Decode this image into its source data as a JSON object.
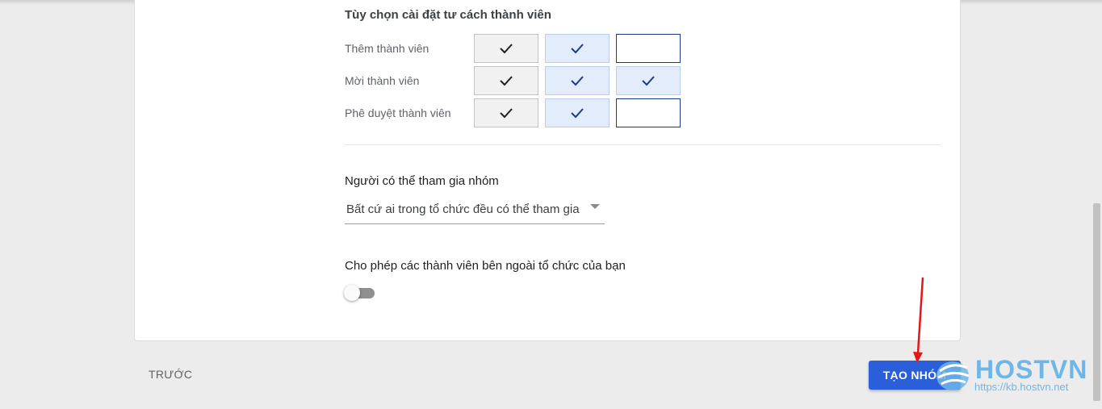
{
  "membership": {
    "title": "Tùy chọn cài đặt tư cách thành viên",
    "rows": [
      {
        "label": "Thêm thành viên",
        "cells": [
          true,
          true,
          false
        ]
      },
      {
        "label": "Mời thành viên",
        "cells": [
          true,
          true,
          true
        ]
      },
      {
        "label": "Phê duyệt thành viên",
        "cells": [
          true,
          true,
          false
        ]
      }
    ]
  },
  "join": {
    "title": "Người có thể tham gia nhóm",
    "selected": "Bất cứ ai trong tổ chức đều có thể tham gia"
  },
  "external": {
    "title": "Cho phép các thành viên bên ngoài tổ chức của bạn",
    "enabled": false
  },
  "footer": {
    "prev_label": "TRƯỚC",
    "create_label": "TẠO NHÓM"
  },
  "watermark": {
    "brand": "HOSTVN",
    "url": "https://kb.hostvn.net"
  },
  "icons": {
    "check": "check-icon",
    "caret": "dropdown-caret-icon",
    "annotation": "red-arrow-annotation"
  },
  "colors": {
    "primary_button": "#2b5fd9",
    "check_dark": "#202124",
    "check_blue": "#1a3a8a",
    "annotation_red": "#e5161b"
  }
}
